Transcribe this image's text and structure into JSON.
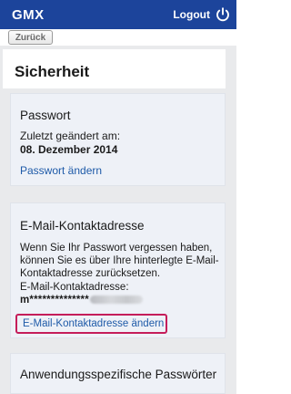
{
  "header": {
    "logo": "GMX",
    "logout_label": "Logout",
    "logout_icon": "power-icon",
    "background_color": "#1c449b"
  },
  "toolbar": {
    "back_label": "Zurück"
  },
  "page": {
    "title": "Sicherheit"
  },
  "password_card": {
    "title": "Passwort",
    "changed_label": "Zuletzt geändert am:",
    "changed_date": "08. Dezember 2014",
    "change_link": "Passwort ändern"
  },
  "email_card": {
    "title": "E-Mail-Kontaktadresse",
    "description": "Wenn Sie Ihr Passwort vergessen haben, können Sie es über Ihre hinterlegte E-Mail-Kontaktadresse zurücksetzen.",
    "address_label": "E-Mail-Kontaktadresse:",
    "address_masked": "m**************",
    "change_link": "E-Mail-Kontaktadresse ändern",
    "highlight_color": "#c51d5a"
  },
  "app_passwords_card": {
    "title": "Anwendungsspezifische Passwörter"
  },
  "colors": {
    "link": "#1e5aa8",
    "background": "#e9eaec",
    "card": "#eef1f7"
  }
}
